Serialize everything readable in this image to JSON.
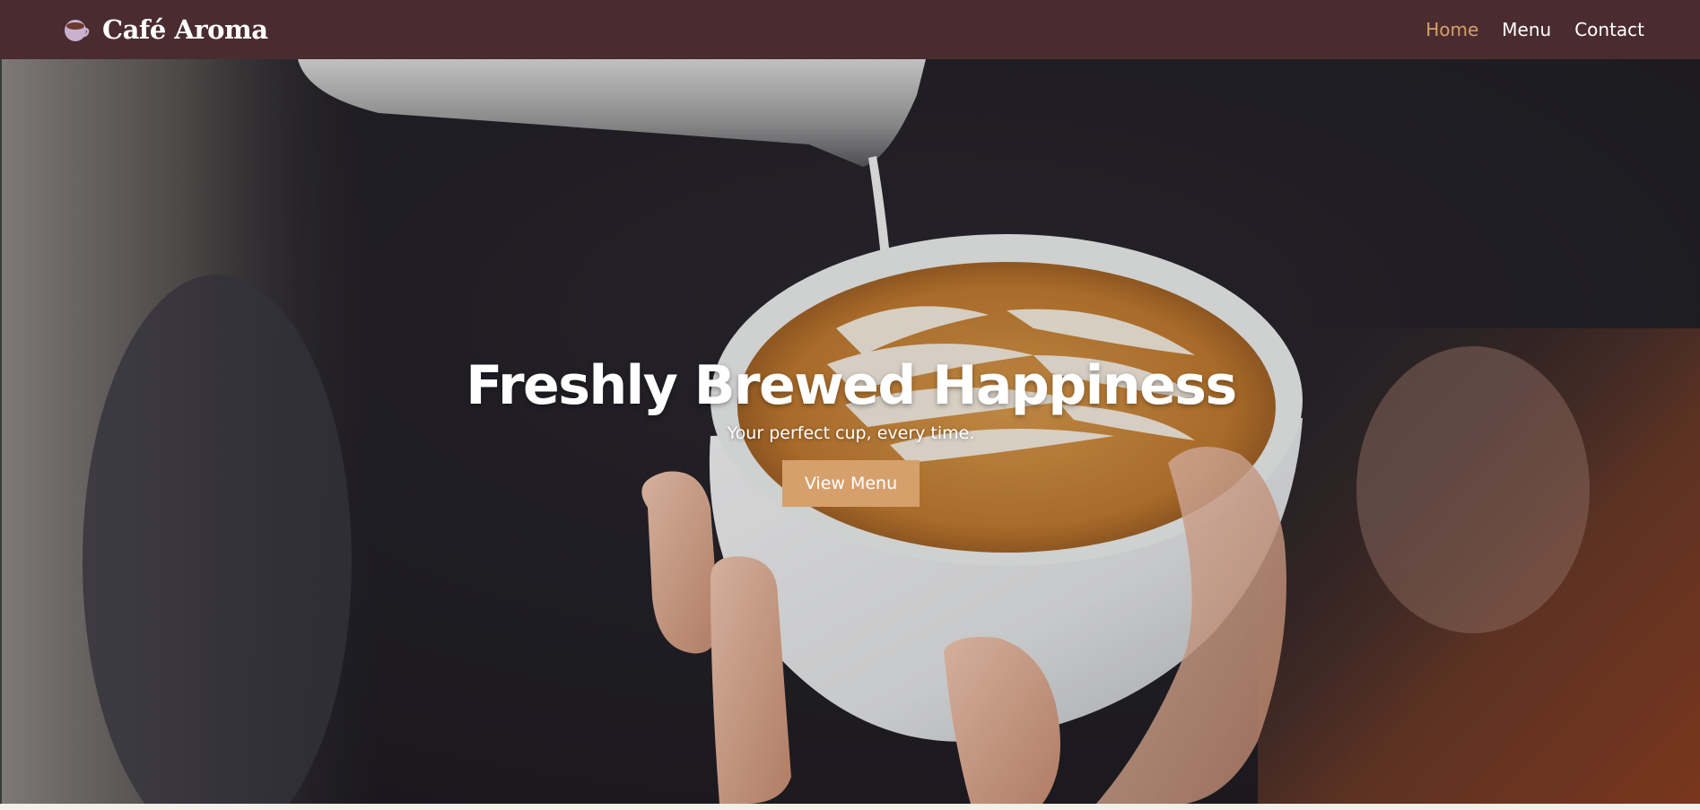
{
  "brand": {
    "name": "Café Aroma",
    "icon": "coffee-cup-icon"
  },
  "nav": {
    "items": [
      {
        "label": "Home",
        "active": true
      },
      {
        "label": "Menu",
        "active": false
      },
      {
        "label": "Contact",
        "active": false
      }
    ]
  },
  "hero": {
    "title": "Freshly Brewed Happiness",
    "subtitle": "Your perfect cup, every time.",
    "button_label": "View Menu",
    "image": "latte-art-pour-photo"
  },
  "colors": {
    "navbar_bg": "#4a2c30",
    "accent": "#d6a06c",
    "text_light": "#ffffff",
    "page_bg": "#f3efe9"
  }
}
